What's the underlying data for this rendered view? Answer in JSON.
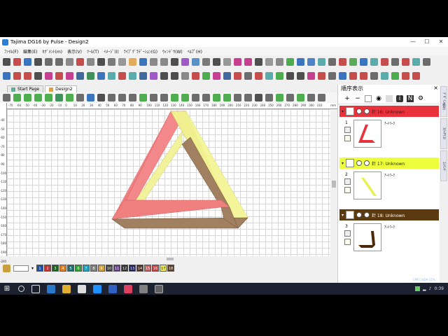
{
  "window": {
    "title": "Tajima DG16 by Pulse - Design2",
    "controls": [
      "—",
      "☐",
      "✕"
    ]
  },
  "menu": [
    "ﾌｧｲﾙ(F)",
    "編集(E)",
    "ｾｸﾞﾒﾝﾄ(m)",
    "表示(V)",
    "ﾂｰﾙ(T)",
    "ｲﾒｰｼﾞ(I)",
    "ﾗｲﾌﾞｸﾞﾗﾃﾞｰｼｮﾝ(G)",
    "ｳｨﾝﾄﾞｳ(W)",
    "ﾍﾙﾌﾟ(H)"
  ],
  "tabs": [
    {
      "label": "Start Page",
      "active": false
    },
    {
      "label": "Design2",
      "active": true
    }
  ],
  "ruler": {
    "h_ticks": [
      "-70",
      "-60",
      "-50",
      "-40",
      "-30",
      "-20",
      "-10",
      "0",
      "10",
      "20",
      "30",
      "40",
      "50",
      "60",
      "70",
      "80",
      "90",
      "100",
      "110",
      "120",
      "130",
      "140",
      "150",
      "160",
      "170",
      "180",
      "190",
      "200",
      "210",
      "220",
      "230",
      "240",
      "250",
      "260",
      "270",
      "280",
      "290",
      "300",
      "310"
    ],
    "unit": "mm",
    "v_ticks": [
      "-40",
      "-50",
      "-60",
      "-70",
      "-80",
      "-90",
      "-100",
      "-110",
      "-120",
      "-130",
      "-140",
      "-150",
      "-160",
      "-170",
      "-180",
      "-190",
      "-200"
    ]
  },
  "colorbar": {
    "current_value": "",
    "swatches": [
      {
        "n": "1",
        "color": "#1f4fa0"
      },
      {
        "n": "2",
        "color": "#c03030"
      },
      {
        "n": "3",
        "color": "#206020"
      },
      {
        "n": "4",
        "color": "#e08020"
      },
      {
        "n": "5",
        "color": "#207070"
      },
      {
        "n": "6",
        "color": "#30a030"
      },
      {
        "n": "7",
        "color": "#20a0c0"
      },
      {
        "n": "8",
        "color": "#808080"
      },
      {
        "n": "9",
        "color": "#d0a040"
      },
      {
        "n": "10",
        "color": "#404040"
      },
      {
        "n": "11",
        "color": "#604080"
      },
      {
        "n": "12",
        "color": "#303030"
      },
      {
        "n": "13",
        "color": "#202060"
      },
      {
        "n": "14",
        "color": "#503020"
      },
      {
        "n": "15",
        "color": "#c06060"
      },
      {
        "n": "16",
        "color": "#d04040"
      },
      {
        "n": "17",
        "color": "#f0f060"
      },
      {
        "n": "18",
        "color": "#604020"
      }
    ]
  },
  "panel": {
    "title": "順序表示",
    "objects": [
      {
        "num": "1",
        "header": "針 16: Unknown",
        "label": "ｱｰﾄﾜｰｸ",
        "header_color": "#e8333c",
        "shape_color": "#e8333c"
      },
      {
        "num": "2",
        "header": "針 17: Unknown",
        "label": "ｱｰﾄﾜｰｸ",
        "header_color": "#ecfe3c",
        "shape_color": "#e8f04a"
      },
      {
        "num": "3",
        "header": "針 18: Unknown",
        "label": "ｱｰﾄﾜｰｸ",
        "header_color": "#5c3a10",
        "shape_color": "#4a2a08"
      }
    ]
  },
  "side_tabs": [
    "ﾃﾞｻﾞｲﾝ表示",
    "ｽﾃｯﾁﾘｽﾄ",
    "ｺﾝﾃﾝﾂ"
  ],
  "design_colors": {
    "red": "#f08080",
    "yellow": "#f0f090",
    "brown": "#a08060"
  },
  "taskbar": {
    "tray_text": "0:39",
    "corner_text": "CMU 16QH 15%"
  }
}
